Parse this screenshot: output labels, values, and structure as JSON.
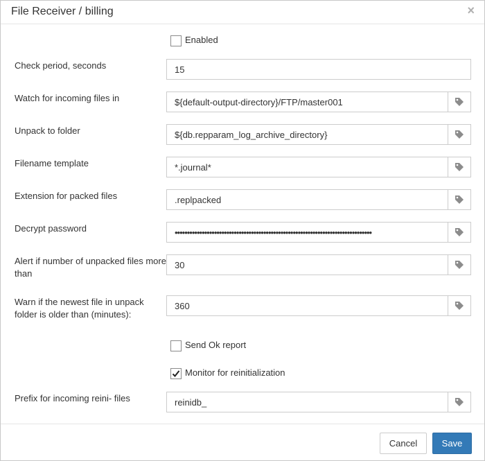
{
  "dialog": {
    "title": "File Receiver / billing",
    "close_symbol": "×"
  },
  "form": {
    "enabled": {
      "label": "Enabled",
      "checked": false
    },
    "check_period": {
      "label": "Check period, seconds",
      "value": "15"
    },
    "watch_folder": {
      "label": "Watch for incoming files in",
      "value": "${default-output-directory}/FTP/master001"
    },
    "unpack_folder": {
      "label": "Unpack to folder",
      "value": "${db.repparam_log_archive_directory}"
    },
    "filename_template": {
      "label": "Filename template",
      "value": "*.journal*"
    },
    "packed_extension": {
      "label": "Extension for packed files",
      "value": ".replpacked"
    },
    "decrypt_password": {
      "label": "Decrypt password",
      "value": "••••••••••••••••••••••••••••••••••••••••••••••••••••••••••••••••••••••••••••••••"
    },
    "alert_unpacked": {
      "label": "Alert if number of unpacked files more than",
      "value": "30"
    },
    "warn_newest": {
      "label": "Warn if the newest file in unpack folder is older than (minutes):",
      "value": "360"
    },
    "send_ok_report": {
      "label": "Send Ok report",
      "checked": false
    },
    "monitor_reinit": {
      "label": "Monitor for reinitialization",
      "checked": true
    },
    "reini_prefix": {
      "label": "Prefix for incoming reini- files",
      "value": "reinidb_"
    }
  },
  "footer": {
    "cancel_label": "Cancel",
    "save_label": "Save"
  },
  "colors": {
    "primary": "#337ab7",
    "border": "#cccccc",
    "icon": "#8c8c8c"
  }
}
